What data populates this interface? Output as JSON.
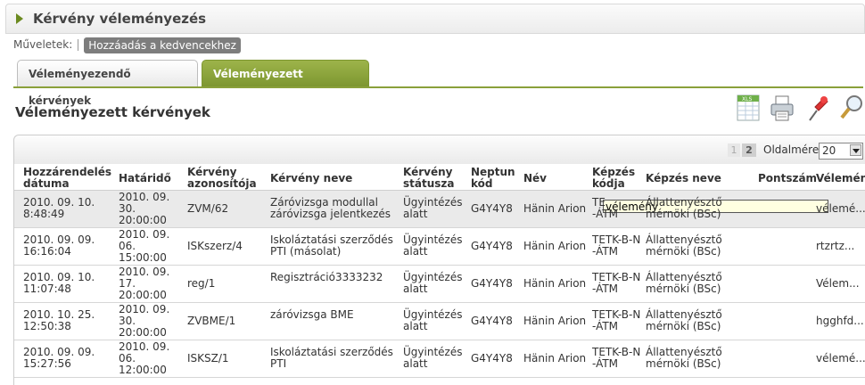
{
  "title": "Kérvény véleményezés",
  "ops": {
    "label": "Műveletek:",
    "fav": "Hozzáadás a kedvencekhez"
  },
  "tabs": [
    {
      "label": "Véleményezendő kérvények"
    },
    {
      "label": "Véleményezett kérvények"
    }
  ],
  "section_title": "Véleményezett kérvények",
  "pager": {
    "page1": "1",
    "page2": "2",
    "size_label": "Oldalméret",
    "size_value": "20"
  },
  "columns": [
    "Hozzárendelés dátuma",
    "Határidő",
    "Kérvény azonosítója",
    "Kérvény neve",
    "Kérvény státusza",
    "Neptun kód",
    "Név",
    "Képzés kódja",
    "Képzés neve",
    "Pontszám",
    "Vélemény"
  ],
  "rows": [
    {
      "date1": "2010. 09. 10.",
      "date2": "8:48:49",
      "dl1": "2010. 09.",
      "dl2": "30.",
      "dl3": "20:00:00",
      "id": "ZVM/62",
      "name1": "Záróvizsga modullal",
      "name2": "záróvizsga jelentkezés",
      "st1": "Ügyintézés",
      "st2": "alatt",
      "neptun": "G4Y4Y8",
      "nev": "Hänin Arion",
      "kk1": "TE",
      "kk2": "-ÁTM",
      "kn1": "Állattenyésztő",
      "kn2": "mérnöki (BSc)",
      "pont": "",
      "vel": "vélemé..."
    },
    {
      "date1": "2010. 09. 09.",
      "date2": "16:16:04",
      "dl1": "2010. 09.",
      "dl2": "06.",
      "dl3": "15:00:00",
      "id": "ISKszerz/4",
      "name1": "Iskoláztatási szerződés",
      "name2": "PTI (másolat)",
      "st1": "Ügyintézés",
      "st2": "alatt",
      "neptun": "G4Y4Y8",
      "nev": "Hänin Arion",
      "kk1": "TETK-B-N",
      "kk2": "-ÁTM",
      "kn1": "Állattenyésztő",
      "kn2": "mérnöki (BSc)",
      "pont": "",
      "vel": "rtzrtz..."
    },
    {
      "date1": "2010. 09. 10.",
      "date2": "11:07:48",
      "dl1": "2010. 09.",
      "dl2": "17.",
      "dl3": "20:00:00",
      "id": "reg/1",
      "name1": "Regisztráció3333232",
      "name2": "",
      "st1": "Ügyintézés",
      "st2": "alatt",
      "neptun": "G4Y4Y8",
      "nev": "Hänin Arion",
      "kk1": "TETK-B-N",
      "kk2": "-ÁTM",
      "kn1": "Állattenyésztő",
      "kn2": "mérnöki (BSc)",
      "pont": "",
      "vel": "Vélem..."
    },
    {
      "date1": "2010. 10. 25.",
      "date2": "12:50:38",
      "dl1": "2010. 09.",
      "dl2": "30.",
      "dl3": "20:00:00",
      "id": "ZVBME/1",
      "name1": "záróvizsga BME",
      "name2": "",
      "st1": "Ügyintézés",
      "st2": "alatt",
      "neptun": "G4Y4Y8",
      "nev": "Hänin Arion",
      "kk1": "TETK-B-N",
      "kk2": "-ÁTM",
      "kn1": "Állattenyésztő",
      "kn2": "mérnöki (BSc)",
      "pont": "",
      "vel": "hgghfd..."
    },
    {
      "date1": "2010. 09. 09.",
      "date2": "15:27:56",
      "dl1": "2010. 09.",
      "dl2": "06.",
      "dl3": "12:00:00",
      "id": "ISKSZ/1",
      "name1": "Iskoláztatási szerződés",
      "name2": "PTI",
      "st1": "Ügyintézés",
      "st2": "alatt",
      "neptun": "G4Y4Y8",
      "nev": "Hänin Arion",
      "kk1": "TETK-B-N",
      "kk2": "-ÁTM",
      "kn1": "Állattenyésztő",
      "kn2": "mérnöki (BSc)",
      "pont": "",
      "vel": "vélemé..."
    }
  ],
  "tooltip": "vélemény",
  "icons": [
    "xls-export-icon",
    "print-icon",
    "pin-icon",
    "search-icon"
  ]
}
